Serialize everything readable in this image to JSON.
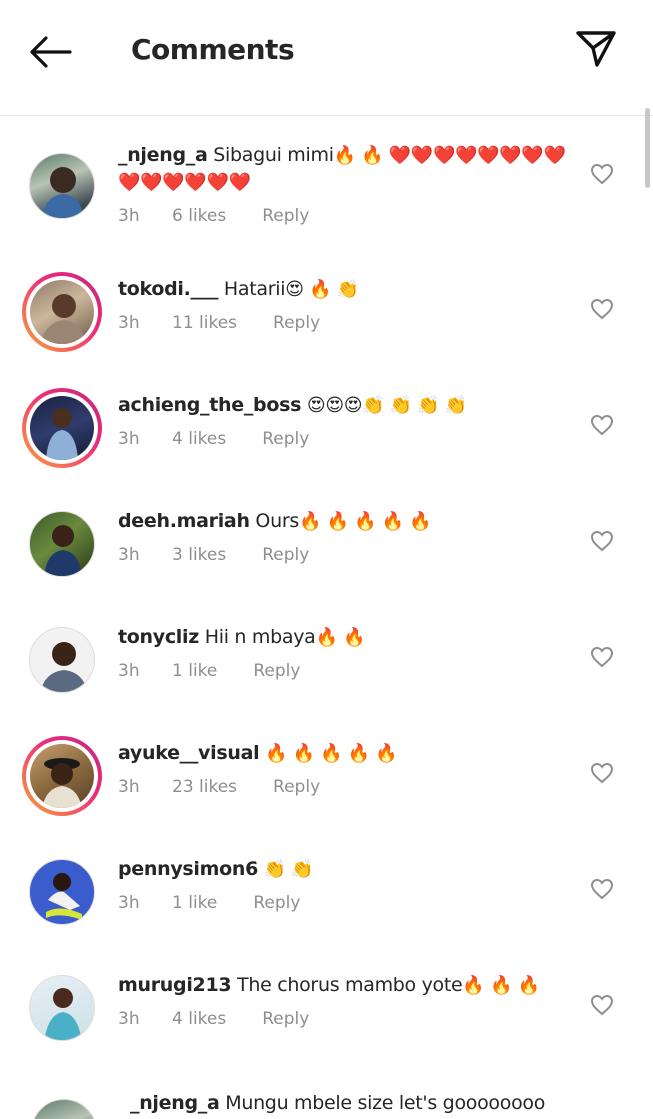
{
  "header": {
    "title": "Comments",
    "back_icon": "arrow-left-icon",
    "send_icon": "paper-plane-icon"
  },
  "colors": {
    "text": "#262626",
    "muted": "#8e8e8e",
    "story_ring": [
      "#f9a53a",
      "#ee2a7b"
    ]
  },
  "comments": [
    {
      "username": "_njeng_a",
      "text": "Sibagui mimi",
      "emoji": "🔥 🔥 ❤️❤️❤️❤️❤️❤️❤️❤️❤️❤️❤️❤️❤️❤️",
      "time": "3h",
      "likes": "6 likes",
      "reply": "Reply",
      "story_ring": false
    },
    {
      "username": "tokodi.___",
      "text": "Hatarii",
      "emoji": "😍 🔥 👏",
      "time": "3h",
      "likes": "11 likes",
      "reply": "Reply",
      "story_ring": true
    },
    {
      "username": "achieng_the_boss",
      "text": "",
      "emoji": "😍😍😍👏 👏 👏 👏",
      "time": "3h",
      "likes": "4 likes",
      "reply": "Reply",
      "story_ring": true
    },
    {
      "username": "deeh.mariah",
      "text": "Ours",
      "emoji": "🔥 🔥 🔥 🔥 🔥",
      "time": "3h",
      "likes": "3 likes",
      "reply": "Reply",
      "story_ring": false
    },
    {
      "username": "tonycliz",
      "text": "Hii n mbaya",
      "emoji": "🔥 🔥",
      "time": "3h",
      "likes": "1 like",
      "reply": "Reply",
      "story_ring": false
    },
    {
      "username": "ayuke__visual",
      "text": "",
      "emoji": "🔥 🔥 🔥 🔥 🔥",
      "time": "3h",
      "likes": "23 likes",
      "reply": "Reply",
      "story_ring": true
    },
    {
      "username": "pennysimon6",
      "text": "",
      "emoji": "👏 👏",
      "time": "3h",
      "likes": "1 like",
      "reply": "Reply",
      "story_ring": false
    },
    {
      "username": "murugi213",
      "text": "The chorus mambo yote",
      "emoji": "🔥 🔥 🔥",
      "time": "3h",
      "likes": "4 likes",
      "reply": "Reply",
      "story_ring": false
    }
  ],
  "partial_comment": {
    "username": "_njeng_a",
    "text": "Mungu mbele size let's goooooooo"
  }
}
